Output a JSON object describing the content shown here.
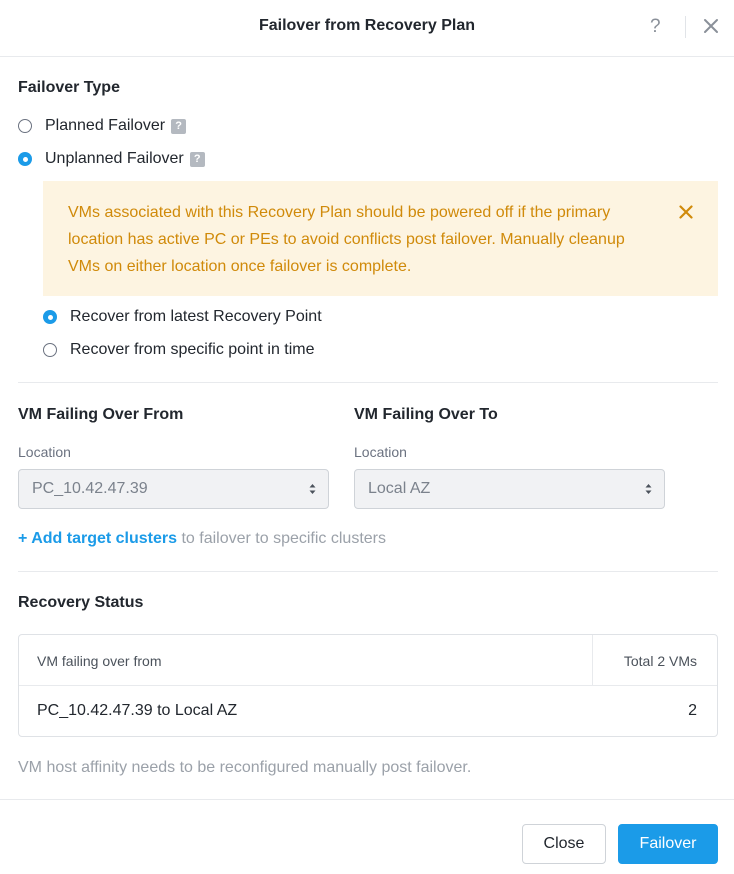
{
  "dialog": {
    "title": "Failover from Recovery Plan",
    "help_glyph": "?"
  },
  "failover_type": {
    "title": "Failover Type",
    "options": [
      {
        "label": "Planned Failover",
        "selected": false
      },
      {
        "label": "Unplanned Failover",
        "selected": true
      }
    ]
  },
  "warning": {
    "text": "VMs associated with this Recovery Plan should be powered off if the primary location has active PC or PEs to avoid conflicts post failover. Manually cleanup VMs on either location once failover is complete.",
    "color": "#d08a0a",
    "background": "#fdf4e1"
  },
  "recovery_point": {
    "options": [
      {
        "label": "Recover from latest Recovery Point",
        "selected": true
      },
      {
        "label": "Recover from specific point in time",
        "selected": false
      }
    ]
  },
  "from": {
    "title": "VM Failing Over From",
    "location_label": "Location",
    "location_value": "PC_10.42.47.39"
  },
  "to": {
    "title": "VM Failing Over To",
    "location_label": "Location",
    "location_value": "Local AZ"
  },
  "add_target": {
    "link": "+ Add target clusters",
    "rest": "to failover to specific clusters"
  },
  "recovery_status": {
    "title": "Recovery Status",
    "columns": [
      "VM failing over from",
      "Total 2 VMs"
    ],
    "rows": [
      {
        "name": "PC_10.42.47.39 to Local AZ",
        "count": "2"
      }
    ]
  },
  "note": "VM host affinity needs to be reconfigured manually post failover.",
  "buttons": {
    "close": "Close",
    "failover": "Failover"
  },
  "colors": {
    "accent": "#1b9be8"
  }
}
